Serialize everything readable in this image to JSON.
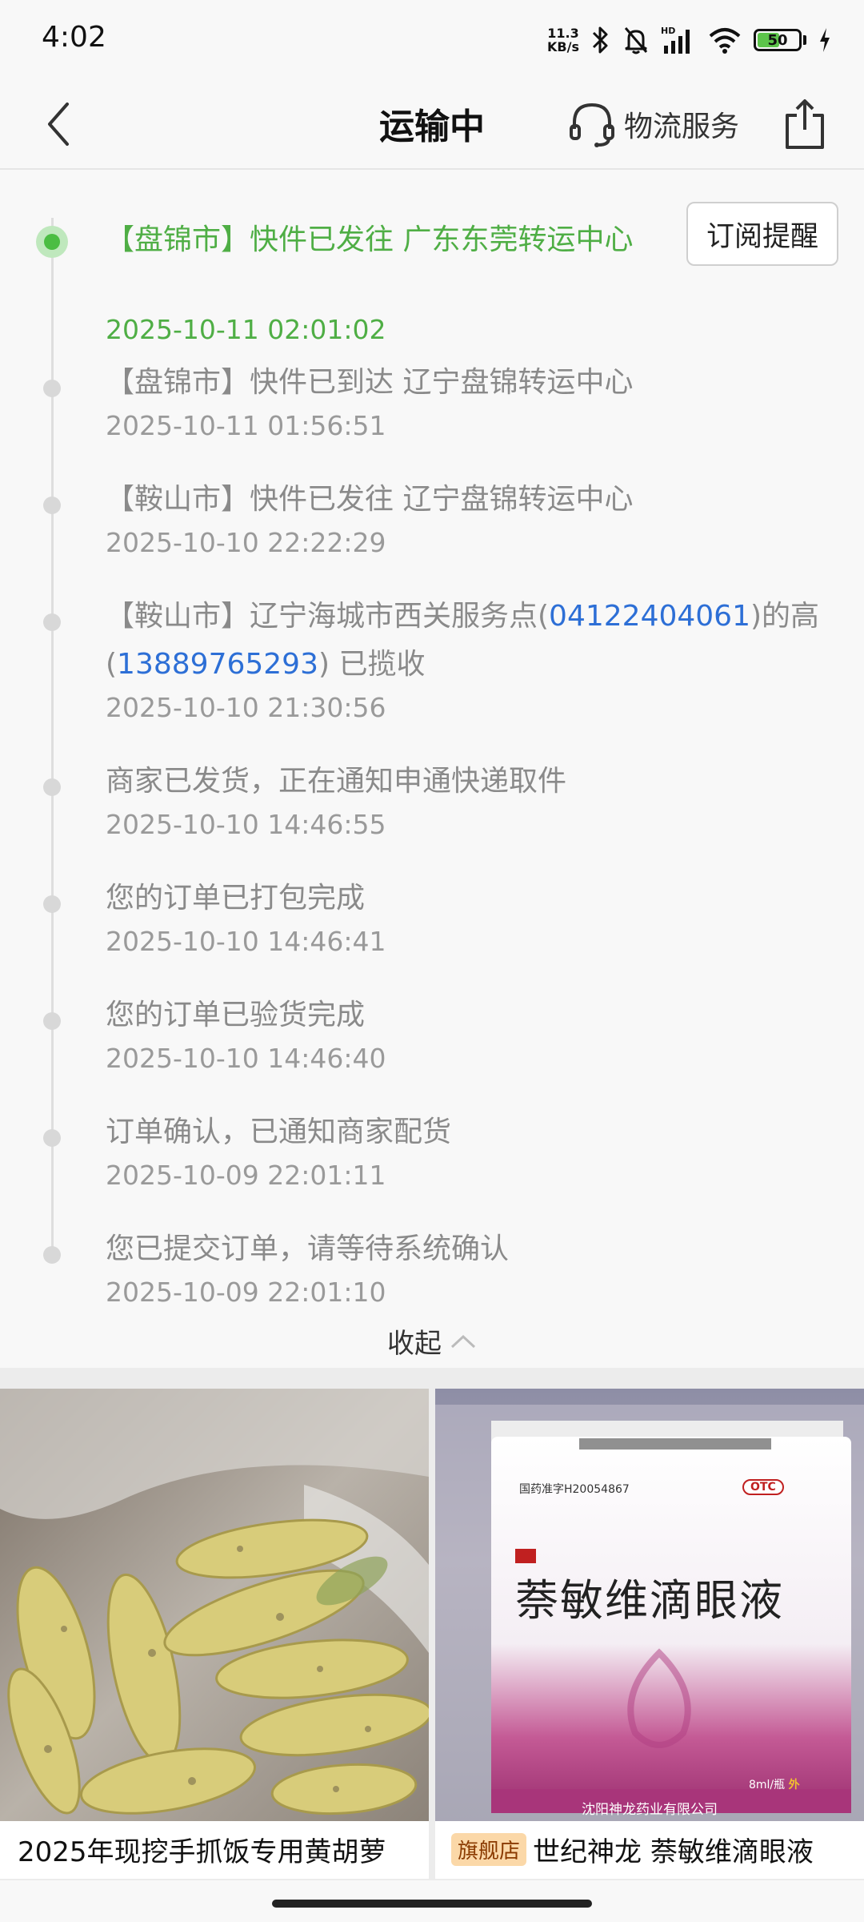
{
  "status_bar": {
    "time": "4:02",
    "net_speed_value": "11.3",
    "net_speed_unit": "KB/s",
    "battery": "50",
    "battery_level": 0.5,
    "icons": [
      "bluetooth-icon",
      "mute-bell-icon",
      "signal-icon",
      "wifi-icon",
      "battery-icon",
      "charging-icon"
    ]
  },
  "nav": {
    "title": "运输中",
    "logistics_label": "物流服务"
  },
  "subscribe_label": "订阅提醒",
  "events": [
    {
      "text": "【盘锦市】快件已发往 广东东莞转运中心",
      "time": "2025-10-11 02:01:02",
      "current": true
    },
    {
      "text": "【盘锦市】快件已到达 辽宁盘锦转运中心",
      "time": "2025-10-11 01:56:51"
    },
    {
      "text": "【鞍山市】快件已发往 辽宁盘锦转运中心",
      "time": "2025-10-10 22:22:29"
    },
    {
      "text_prefix": "【鞍山市】辽宁海城市西关服务点(",
      "phone1": "04122404061",
      "text_mid": ")的高(",
      "phone2": "13889765293",
      "text_suffix": ") 已揽收",
      "time": "2025-10-10 21:30:56"
    },
    {
      "text": "商家已发货，正在通知申通快递取件",
      "time": "2025-10-10 14:46:55"
    },
    {
      "text": "您的订单已打包完成",
      "time": "2025-10-10 14:46:41"
    },
    {
      "text": "您的订单已验货完成",
      "time": "2025-10-10 14:46:40"
    },
    {
      "text": "订单确认，已通知商家配货",
      "time": "2025-10-09 22:01:11"
    },
    {
      "text": "您已提交订单，请等待系统确认",
      "time": "2025-10-09 22:01:10"
    }
  ],
  "collapse_label": "收起",
  "recommendations": [
    {
      "title": "2025年现挖手抓饭专用黄胡萝"
    },
    {
      "badge": "旗舰店",
      "title": "世纪神龙 萘敏维滴眼液",
      "box_approval": "国药准字H20054867",
      "box_otc": "OTC",
      "box_name": "萘敏维滴眼液",
      "box_spec": "8ml/瓶",
      "box_ext": "外",
      "box_maker": "沈阳神龙药业有限公司"
    }
  ],
  "colors": {
    "accent_green": "#4fae45",
    "phone_blue": "#2d6fd6",
    "inactive_text": "#8a8a8a",
    "badge_bg": "#fbd8a8"
  }
}
